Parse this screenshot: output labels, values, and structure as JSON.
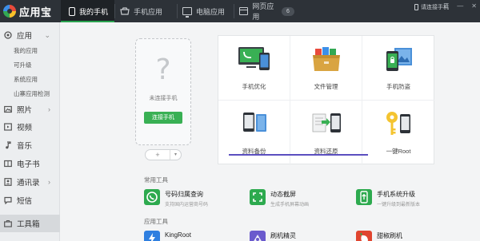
{
  "app": {
    "title": "应用宝"
  },
  "tabs": [
    {
      "label": "我的手机",
      "icon": "phone-icon"
    },
    {
      "label": "手机应用",
      "icon": "apps-icon"
    },
    {
      "label": "电脑应用",
      "icon": "monitor-icon"
    },
    {
      "label": "网页应用",
      "icon": "web-icon"
    }
  ],
  "tab_badge": "6",
  "header": {
    "connect_label": "请连接手机"
  },
  "sidebar": {
    "items": [
      {
        "label": "应用",
        "icon": "apps-icon"
      },
      {
        "label": "照片",
        "icon": "photo-icon"
      },
      {
        "label": "视频",
        "icon": "video-icon"
      },
      {
        "label": "音乐",
        "icon": "music-icon"
      },
      {
        "label": "电子书",
        "icon": "ebook-icon"
      },
      {
        "label": "通讯录",
        "icon": "contacts-icon"
      },
      {
        "label": "短信",
        "icon": "sms-icon"
      },
      {
        "label": "工具箱",
        "icon": "toolbox-icon"
      }
    ],
    "sub_items": [
      "我的应用",
      "可升级",
      "系统应用",
      "山寨应用检测"
    ]
  },
  "device": {
    "status": "未连接手机",
    "connect_button": "连接手机",
    "add_symbol": "+"
  },
  "features": [
    {
      "label": "手机优化",
      "icon": "phone-optimize-icon"
    },
    {
      "label": "文件管理",
      "icon": "file-manager-icon"
    },
    {
      "label": "手机防盗",
      "icon": "anti-theft-icon"
    },
    {
      "label": "资料备份",
      "icon": "backup-icon"
    },
    {
      "label": "资料还原",
      "icon": "restore-icon"
    },
    {
      "label": "一键Root",
      "icon": "root-key-icon"
    }
  ],
  "sections": {
    "common_tools": "常用工具",
    "app_tools": "应用工具"
  },
  "common_tools": [
    {
      "name": "号码归属查询",
      "desc": "支持国内运营商号码",
      "icon": "phone-lookup-icon",
      "color": "#2daa4f"
    },
    {
      "name": "动态截屏",
      "desc": "生成手机屏幕动画",
      "icon": "screenshot-icon",
      "color": "#2daa4f"
    },
    {
      "name": "手机系统升级",
      "desc": "一键升级到最新版本",
      "icon": "system-upgrade-icon",
      "color": "#2daa4f"
    }
  ],
  "app_tools": [
    {
      "name": "KingRoot",
      "icon": "kingroot-icon",
      "color": "#2f7fe0"
    },
    {
      "name": "刷机精灵",
      "icon": "flash-wizard-icon",
      "color": "#6a5acd"
    },
    {
      "name": "甜椒刷机",
      "icon": "pepper-flash-icon",
      "color": "#e0452f"
    }
  ],
  "colors": {
    "accent": "#39b054",
    "topbar": "#2d3238",
    "underline": "#5b4fc0"
  }
}
